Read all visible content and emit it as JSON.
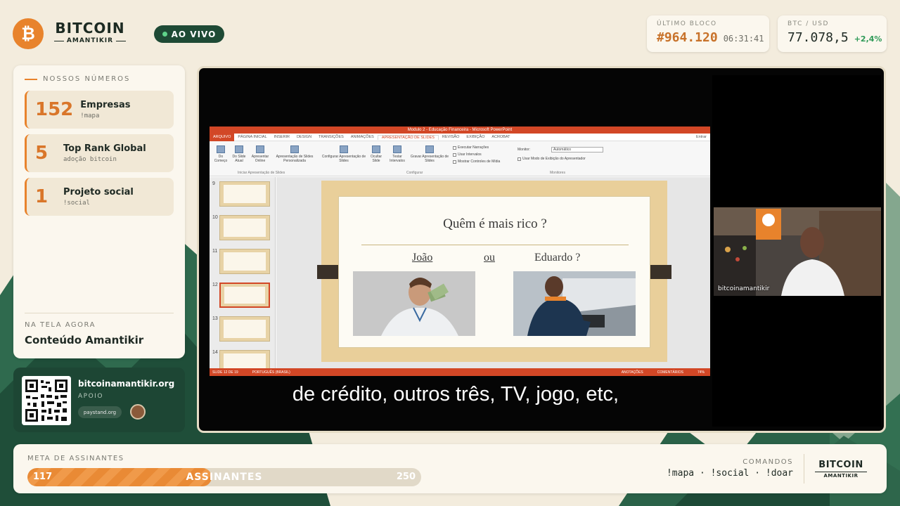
{
  "header": {
    "logo_glyph": "₿",
    "brand_title": "BITCOIN",
    "brand_subtitle": "AMANTIKIR",
    "live_label": "AO VIVO",
    "block": {
      "label": "ÚLTIMO BLOCO",
      "number": "#964.120",
      "time": "06:31:41"
    },
    "price": {
      "label": "BTC / USD",
      "value": "77.078,5",
      "change": "+2,4%"
    }
  },
  "numbers_panel": {
    "label": "NOSSOS NÚMEROS",
    "items": [
      {
        "value": "152",
        "title": "Empresas",
        "sub": "!mapa"
      },
      {
        "value": "5",
        "title": "Top Rank Global",
        "sub": "adoção bitcoin"
      },
      {
        "value": "1",
        "title": "Projeto social",
        "sub": "!social"
      }
    ],
    "now_label": "NA TELA AGORA",
    "now_value": "Conteúdo Amantikir"
  },
  "support": {
    "site": "bitcoinamantikir.org",
    "label": "APOIO",
    "paystand": "paystand.org"
  },
  "screen": {
    "ppt": {
      "window_title": "Modulo 2 - Educação Financeira - Microsoft PowerPoint",
      "tabs": [
        "ARQUIVO",
        "PÁGINA INICIAL",
        "INSERIR",
        "DESIGN",
        "TRANSIÇÕES",
        "ANIMAÇÕES",
        "APRESENTAÇÃO DE SLIDES",
        "REVISÃO",
        "EXIBIÇÃO",
        "ACROBAT"
      ],
      "signin": "Entrar",
      "ribbon_buttons": [
        "Do Começo",
        "Do Slide Atual",
        "Apresentar Online",
        "Apresentação de Slides Personalizada",
        "Configurar Apresentação de Slides",
        "Ocultar Slide",
        "Testar Intervalos",
        "Gravar Apresentação de Slides"
      ],
      "ribbon_checks": [
        "Executar Narrações",
        "Usar Intervalos",
        "Mostrar Controles de Mídia",
        "Usar Modo de Exibição do Apresentador"
      ],
      "monitor_label": "Monitor:",
      "monitor_value": "Automático",
      "group_labels": [
        "Iniciar Apresentação de Slides",
        "Configurar",
        "Monitores"
      ],
      "thumbnails": [
        "9",
        "10",
        "11",
        "12",
        "13",
        "14"
      ],
      "selected_thumb": "12",
      "slide_title": "Quêm é mais rico ?",
      "slide_left": "João",
      "slide_mid": "ou",
      "slide_right": "Eduardo ?",
      "status_slide": "SLIDE 12 DE 19",
      "status_lang": "PORTUGUÊS (BRASIL)",
      "status_notes": "ANOTAÇÕES",
      "status_comments": "COMENTÁRIOS",
      "status_zoom": "74%"
    },
    "cam_name": "bitcoinamantikir",
    "caption": "de crédito, outros três, TV, jogo, etc,"
  },
  "bottom": {
    "goal_label": "META DE ASSINANTES",
    "current": "117",
    "center_label": "ASSINANTES",
    "target": "250",
    "progress_fraction": 0.468,
    "commands_label": "COMANDOS",
    "commands": "!mapa · !social · !doar",
    "brand_title": "BITCOIN",
    "brand_subtitle": "AMANTIKIR"
  },
  "colors": {
    "accent": "#e8832c",
    "dark_green": "#1d4634",
    "panel": "#fbf7ee",
    "positive": "#2f9a58",
    "ppt_red": "#d24726"
  }
}
